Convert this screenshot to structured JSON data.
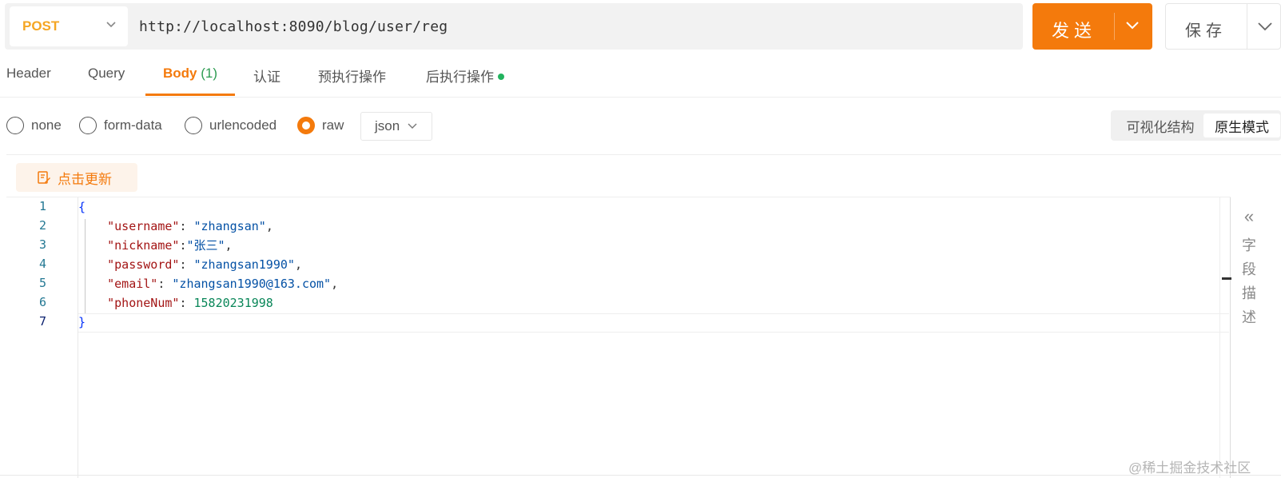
{
  "request": {
    "method": "POST",
    "url": "http://localhost:8090/blog/user/reg",
    "send_label": "发送",
    "save_label": "保存"
  },
  "tabs": [
    {
      "label": "Header"
    },
    {
      "label": "Query"
    },
    {
      "label": "Body",
      "count": "(1)",
      "active": true
    },
    {
      "label": "认证"
    },
    {
      "label": "预执行操作"
    },
    {
      "label": "后执行操作",
      "dot": true
    }
  ],
  "body_types": {
    "options": [
      "none",
      "form-data",
      "urlencoded",
      "raw"
    ],
    "selected": "raw",
    "format": "json"
  },
  "view_modes": {
    "options": [
      "可视化结构",
      "原生模式"
    ],
    "selected": "原生模式"
  },
  "refresh_label": "点击更新",
  "editor": {
    "line_numbers": [
      "1",
      "2",
      "3",
      "4",
      "5",
      "6",
      "7"
    ],
    "current_line": "7",
    "lines": {
      "l1": "{",
      "l2_key": "\"username\"",
      "l2_val": "\"zhangsan\"",
      "l3_key": "\"nickname\"",
      "l3_val": "\"张三\"",
      "l4_key": "\"password\"",
      "l4_val": "\"zhangsan1990\"",
      "l5_key": "\"email\"",
      "l5_val": "\"zhangsan1990@163.com\"",
      "l6_key": "\"phoneNum\"",
      "l6_val": "15820231998",
      "l7": "}"
    }
  },
  "side_panel": {
    "collapse_icon": "«",
    "chars": [
      "字",
      "段",
      "描",
      "述"
    ]
  },
  "watermark": "@稀土掘金技术社区",
  "colors": {
    "accent": "#f47a0c",
    "method": "#f5a623",
    "count": "#2e9c52",
    "dot": "#22b35e"
  }
}
